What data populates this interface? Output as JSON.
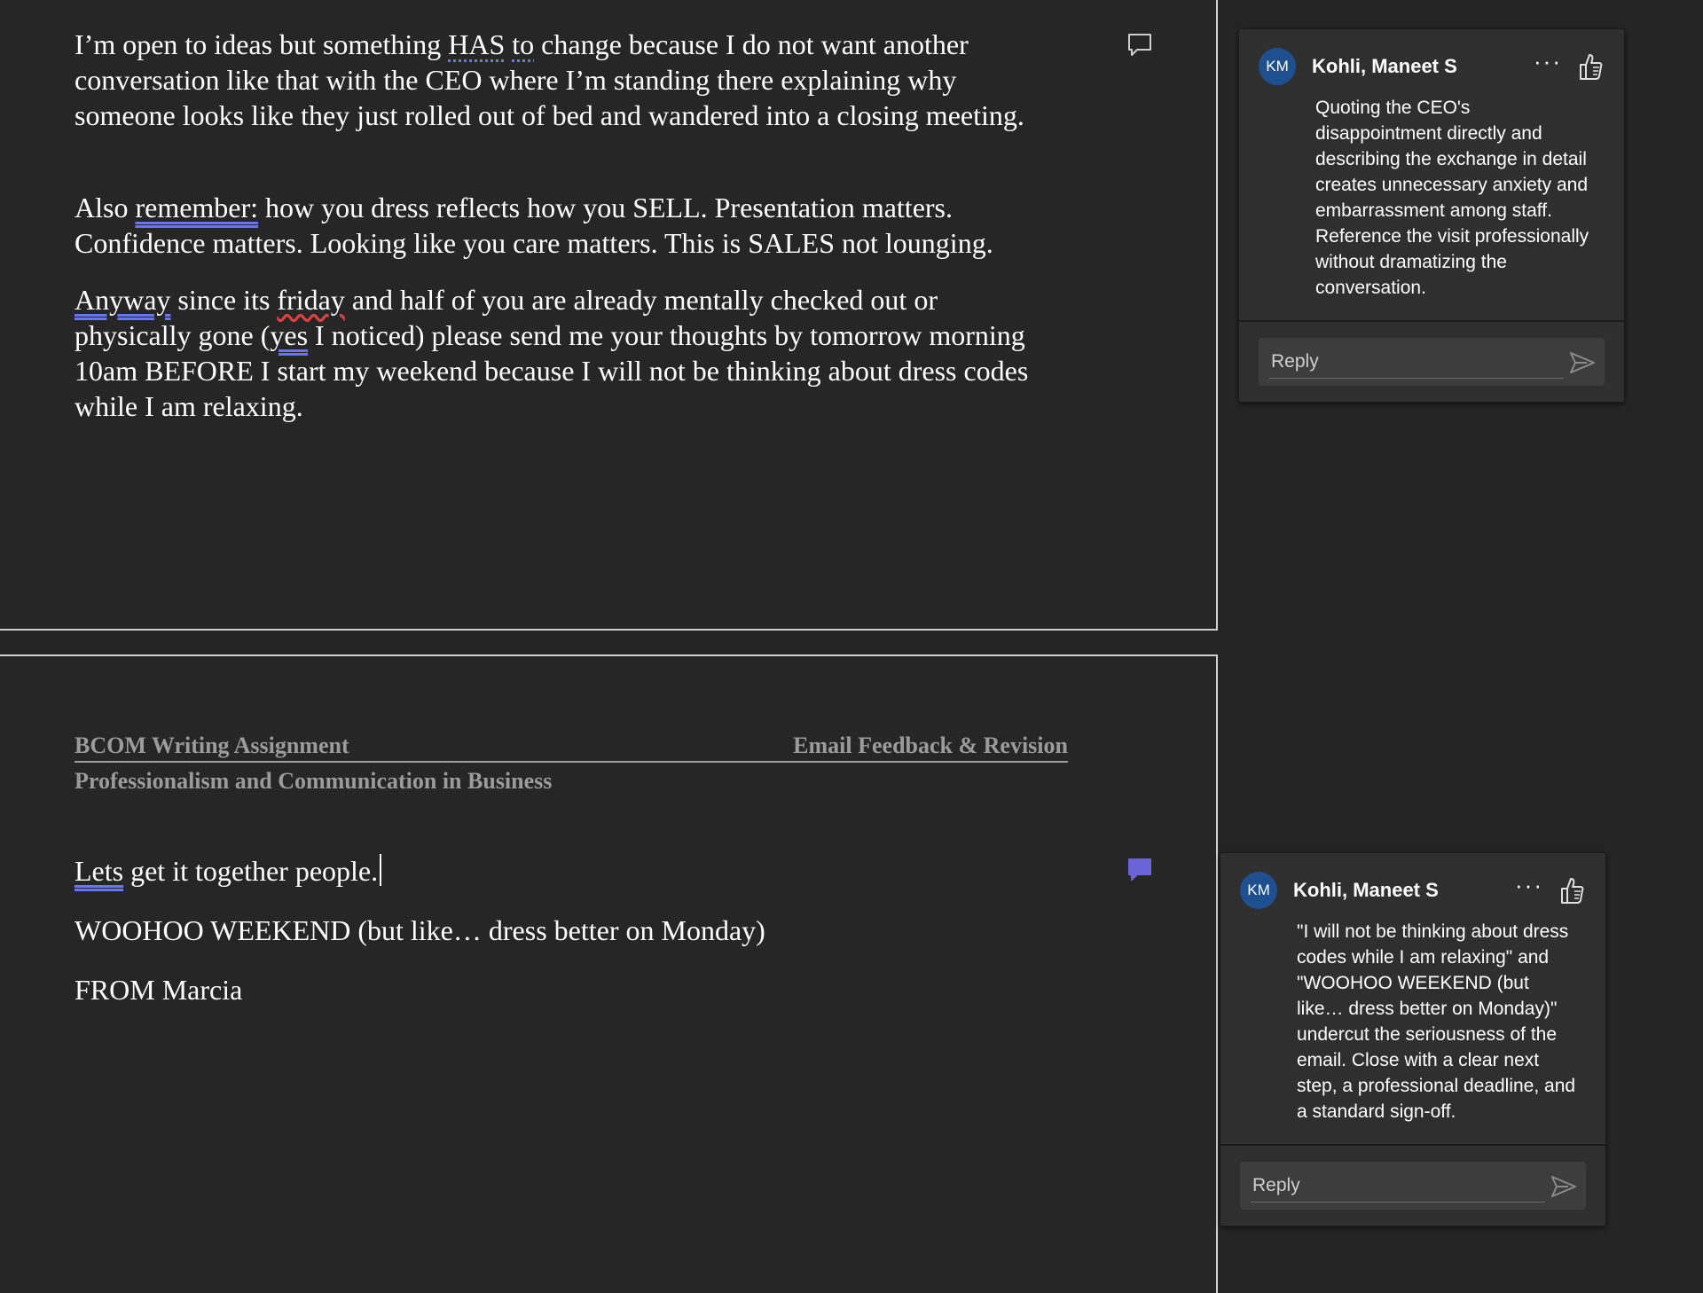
{
  "document": {
    "page1": {
      "para1": {
        "pre": "I’m open to ideas but something ",
        "has": "HAS",
        "sp": " ",
        "to": "to",
        "post": " change because I do not want another conversation like that with the CEO where I’m standing there explaining why someone looks like they just rolled out of bed and wandered into a closing meeting."
      },
      "para2": {
        "pre": "Also ",
        "remember": "remember:",
        "post": " how you dress reflects how you SELL. Presentation matters. Confidence matters. Looking like you care matters. This is SALES not lounging."
      },
      "para3": {
        "anyway": "Anyway",
        "a": " since its ",
        "friday": "friday",
        "b": " and half of you are already mentally checked out or physically gone (",
        "yes": "yes",
        "c": " I noticed) please send me your thoughts by tomorrow morning 10am BEFORE I start my weekend because I will not be thinking about dress codes while I am relaxing."
      }
    },
    "header": {
      "left": "BCOM Writing Assignment",
      "right": "Email Feedback & Revision",
      "sub": "Professionalism and Communication in Business"
    },
    "page2": {
      "line1_a": "Lets",
      "line1_b": " get it together people.",
      "line2": "WOOHOO WEEKEND (but like… dress better on Monday)",
      "line3": "FROM Marcia"
    }
  },
  "comments": [
    {
      "initials": "KM",
      "author": "Kohli, Maneet S",
      "more": "···",
      "text": "Quoting the CEO's disappointment directly and describing the exchange in detail creates unnecessary anxiety and embarrassment among staff. Reference the visit professionally without dramatizing the conversation.",
      "reply_placeholder": "Reply"
    },
    {
      "initials": "KM",
      "author": "Kohli, Maneet S",
      "more": "···",
      "text": "\"I will not be thinking about dress codes while I am relaxing\" and \"WOOHOO WEEKEND (but like… dress better on Monday)\" undercut the seriousness of the email. Close with a clear next step, a professional deadline, and a standard sign-off.",
      "reply_placeholder": "Reply"
    }
  ],
  "colors": {
    "background": "#252525",
    "avatar": "#1e4f8f",
    "active_comment_marker": "#6b63d8",
    "proofing_underline": "#6a74ff",
    "spelling_underline": "#e04040"
  },
  "icons": [
    "comment-icon",
    "like-icon",
    "send-icon",
    "more-icon"
  ]
}
